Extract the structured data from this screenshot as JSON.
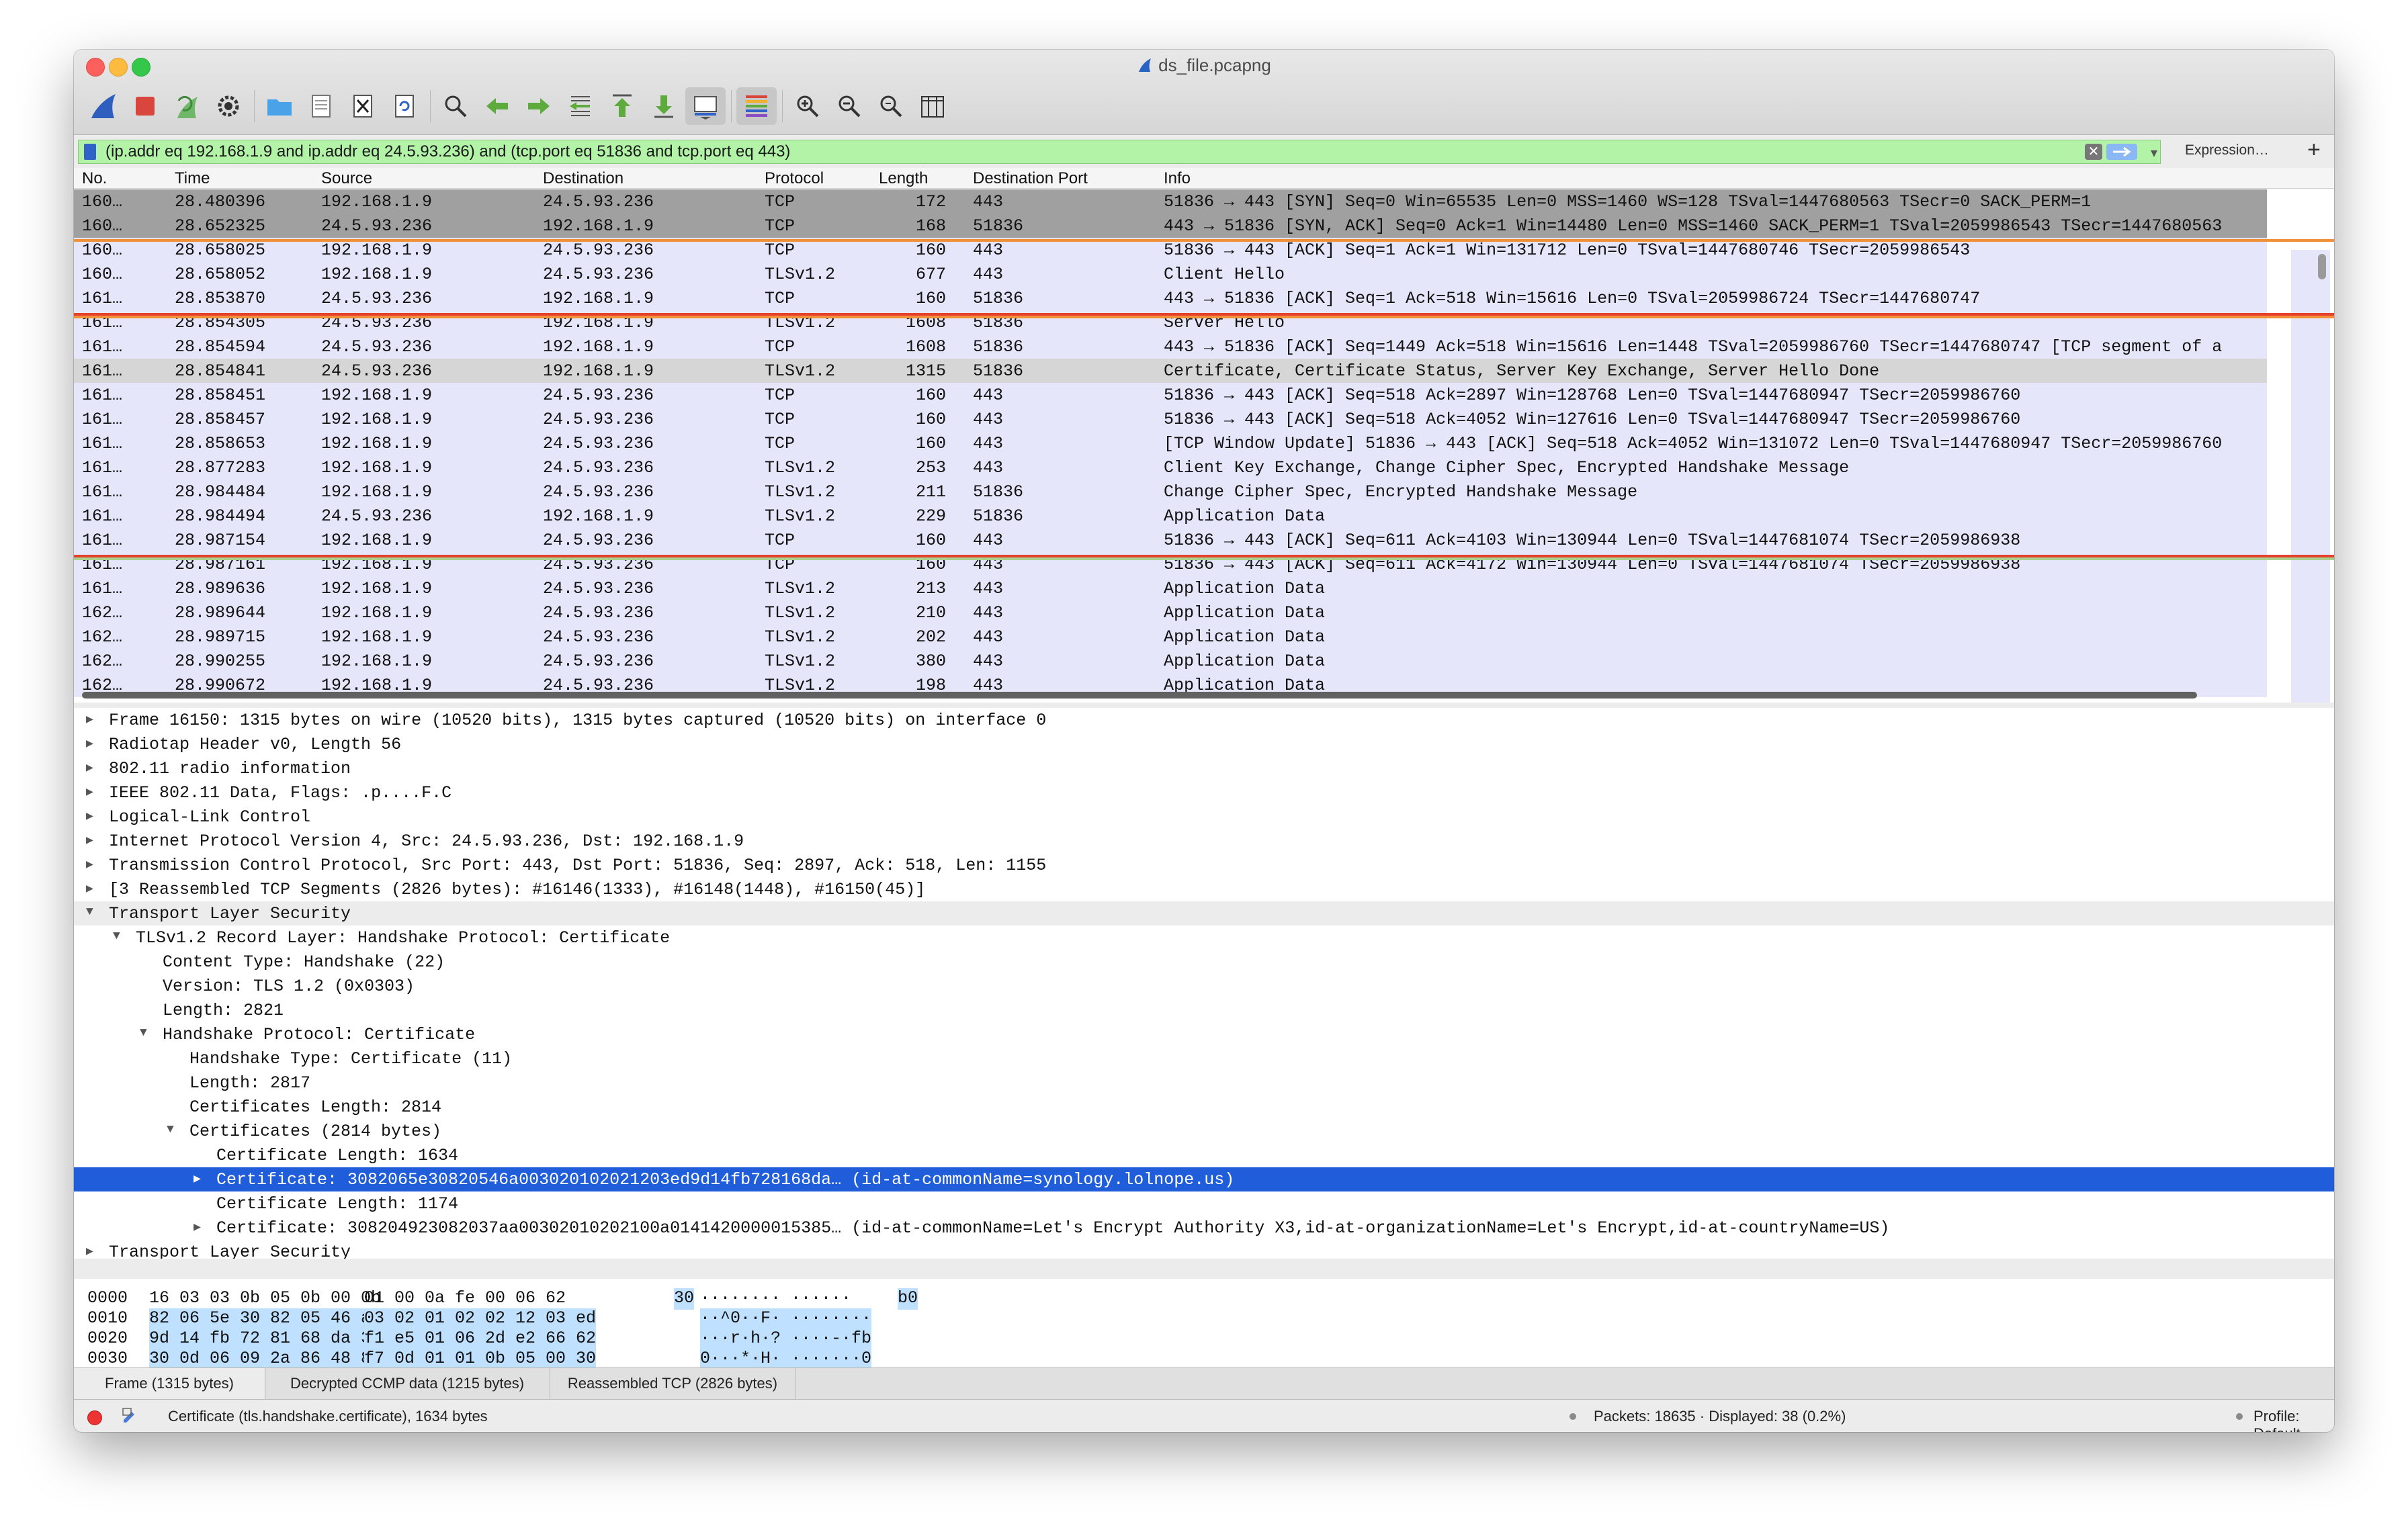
{
  "window": {
    "title": "ds_file.pcapng"
  },
  "filter": {
    "value": "(ip.addr eq 192.168.1.9 and ip.addr eq 24.5.93.236) and (tcp.port eq 51836 and tcp.port eq 443)",
    "expression_label": "Expression…",
    "add_label": "+",
    "clear_glyph": "✕",
    "dropdown_glyph": "▾"
  },
  "columns": [
    "No.",
    "Time",
    "Source",
    "Destination",
    "Protocol",
    "Length",
    "Destination Port",
    "Info"
  ],
  "packets": [
    {
      "no": "160…",
      "time": "28.480396",
      "src": "192.168.1.9",
      "dst": "24.5.93.236",
      "proto": "TCP",
      "len": "172",
      "dport": "443",
      "info": "51836 → 443 [SYN] Seq=0 Win=65535 Len=0 MSS=1460 WS=128 TSval=1447680563 TSecr=0 SACK_PERM=1",
      "style": "dark"
    },
    {
      "no": "160…",
      "time": "28.652325",
      "src": "24.5.93.236",
      "dst": "192.168.1.9",
      "proto": "TCP",
      "len": "168",
      "dport": "51836",
      "info": "443 → 51836 [SYN, ACK] Seq=0 Ack=1 Win=14480 Len=0 MSS=1460 SACK_PERM=1 TSval=2059986543 TSecr=1447680563",
      "style": "dark"
    },
    {
      "no": "160…",
      "time": "28.658025",
      "src": "192.168.1.9",
      "dst": "24.5.93.236",
      "proto": "TCP",
      "len": "160",
      "dport": "443",
      "info": "51836 → 443 [ACK] Seq=1 Ack=1 Win=131712 Len=0 TSval=1447680746 TSecr=2059986543",
      "style": "normal"
    },
    {
      "no": "160…",
      "time": "28.658052",
      "src": "192.168.1.9",
      "dst": "24.5.93.236",
      "proto": "TLSv1.2",
      "len": "677",
      "dport": "443",
      "info": "Client Hello",
      "style": "normal"
    },
    {
      "no": "161…",
      "time": "28.853870",
      "src": "24.5.93.236",
      "dst": "192.168.1.9",
      "proto": "TCP",
      "len": "160",
      "dport": "51836",
      "info": "443 → 51836 [ACK] Seq=1 Ack=518 Win=15616 Len=0 TSval=2059986724 TSecr=1447680747",
      "style": "normal"
    },
    {
      "no": "161…",
      "time": "28.854305",
      "src": "24.5.93.236",
      "dst": "192.168.1.9",
      "proto": "TLSv1.2",
      "len": "1608",
      "dport": "51836",
      "info": "Server Hello",
      "style": "normal"
    },
    {
      "no": "161…",
      "time": "28.854594",
      "src": "24.5.93.236",
      "dst": "192.168.1.9",
      "proto": "TCP",
      "len": "1608",
      "dport": "51836",
      "info": "443 → 51836 [ACK] Seq=1449 Ack=518 Win=15616 Len=1448 TSval=2059986760 TSecr=1447680747 [TCP segment of a",
      "style": "normal"
    },
    {
      "no": "161…",
      "time": "28.854841",
      "src": "24.5.93.236",
      "dst": "192.168.1.9",
      "proto": "TLSv1.2",
      "len": "1315",
      "dport": "51836",
      "info": "Certificate, Certificate Status, Server Key Exchange, Server Hello Done",
      "style": "sel"
    },
    {
      "no": "161…",
      "time": "28.858451",
      "src": "192.168.1.9",
      "dst": "24.5.93.236",
      "proto": "TCP",
      "len": "160",
      "dport": "443",
      "info": "51836 → 443 [ACK] Seq=518 Ack=2897 Win=128768 Len=0 TSval=1447680947 TSecr=2059986760",
      "style": "normal"
    },
    {
      "no": "161…",
      "time": "28.858457",
      "src": "192.168.1.9",
      "dst": "24.5.93.236",
      "proto": "TCP",
      "len": "160",
      "dport": "443",
      "info": "51836 → 443 [ACK] Seq=518 Ack=4052 Win=127616 Len=0 TSval=1447680947 TSecr=2059986760",
      "style": "normal"
    },
    {
      "no": "161…",
      "time": "28.858653",
      "src": "192.168.1.9",
      "dst": "24.5.93.236",
      "proto": "TCP",
      "len": "160",
      "dport": "443",
      "info": "[TCP Window Update] 51836 → 443 [ACK] Seq=518 Ack=4052 Win=131072 Len=0 TSval=1447680947 TSecr=2059986760",
      "style": "normal"
    },
    {
      "no": "161…",
      "time": "28.877283",
      "src": "192.168.1.9",
      "dst": "24.5.93.236",
      "proto": "TLSv1.2",
      "len": "253",
      "dport": "443",
      "info": "Client Key Exchange, Change Cipher Spec, Encrypted Handshake Message",
      "style": "normal"
    },
    {
      "no": "161…",
      "time": "28.984484",
      "src": "192.168.1.9",
      "dst": "24.5.93.236",
      "proto": "TLSv1.2",
      "len": "211",
      "dport": "51836",
      "info": "Change Cipher Spec, Encrypted Handshake Message",
      "style": "normal"
    },
    {
      "no": "161…",
      "time": "28.984494",
      "src": "24.5.93.236",
      "dst": "192.168.1.9",
      "proto": "TLSv1.2",
      "len": "229",
      "dport": "51836",
      "info": "Application Data",
      "style": "normal"
    },
    {
      "no": "161…",
      "time": "28.987154",
      "src": "192.168.1.9",
      "dst": "24.5.93.236",
      "proto": "TCP",
      "len": "160",
      "dport": "443",
      "info": "51836 → 443 [ACK] Seq=611 Ack=4103 Win=130944 Len=0 TSval=1447681074 TSecr=2059986938",
      "style": "normal"
    },
    {
      "no": "161…",
      "time": "28.987161",
      "src": "192.168.1.9",
      "dst": "24.5.93.236",
      "proto": "TCP",
      "len": "160",
      "dport": "443",
      "info": "51836 → 443 [ACK] Seq=611 Ack=4172 Win=130944 Len=0 TSval=1447681074 TSecr=2059986938",
      "style": "normal"
    },
    {
      "no": "161…",
      "time": "28.989636",
      "src": "192.168.1.9",
      "dst": "24.5.93.236",
      "proto": "TLSv1.2",
      "len": "213",
      "dport": "443",
      "info": "Application Data",
      "style": "normal"
    },
    {
      "no": "162…",
      "time": "28.989644",
      "src": "192.168.1.9",
      "dst": "24.5.93.236",
      "proto": "TLSv1.2",
      "len": "210",
      "dport": "443",
      "info": "Application Data",
      "style": "normal"
    },
    {
      "no": "162…",
      "time": "28.989715",
      "src": "192.168.1.9",
      "dst": "24.5.93.236",
      "proto": "TLSv1.2",
      "len": "202",
      "dport": "443",
      "info": "Application Data",
      "style": "normal"
    },
    {
      "no": "162…",
      "time": "28.990255",
      "src": "192.168.1.9",
      "dst": "24.5.93.236",
      "proto": "TLSv1.2",
      "len": "380",
      "dport": "443",
      "info": "Application Data",
      "style": "normal"
    },
    {
      "no": "162…",
      "time": "28.990672",
      "src": "192.168.1.9",
      "dst": "24.5.93.236",
      "proto": "TLSv1.2",
      "len": "198",
      "dport": "443",
      "info": "Application Data",
      "style": "normal"
    }
  ],
  "highlight_colors": {
    "handshake": "#f0913a",
    "tls_setup": "#e8402e",
    "app_data": "#a9d18e"
  },
  "details": [
    {
      "indent": 0,
      "twisty": "▶",
      "text": "Frame 16150: 1315 bytes on wire (10520 bits), 1315 bytes captured (10520 bits) on interface 0",
      "style": "normal"
    },
    {
      "indent": 0,
      "twisty": "▶",
      "text": "Radiotap Header v0, Length 56",
      "style": "normal"
    },
    {
      "indent": 0,
      "twisty": "▶",
      "text": "802.11 radio information",
      "style": "normal"
    },
    {
      "indent": 0,
      "twisty": "▶",
      "text": "IEEE 802.11 Data, Flags: .p....F.C",
      "style": "normal"
    },
    {
      "indent": 0,
      "twisty": "▶",
      "text": "Logical-Link Control",
      "style": "normal"
    },
    {
      "indent": 0,
      "twisty": "▶",
      "text": "Internet Protocol Version 4, Src: 24.5.93.236, Dst: 192.168.1.9",
      "style": "normal"
    },
    {
      "indent": 0,
      "twisty": "▶",
      "text": "Transmission Control Protocol, Src Port: 443, Dst Port: 51836, Seq: 2897, Ack: 518, Len: 1155",
      "style": "normal"
    },
    {
      "indent": 0,
      "twisty": "▶",
      "text": "[3 Reassembled TCP Segments (2826 bytes): #16146(1333), #16148(1448), #16150(45)]",
      "style": "normal"
    },
    {
      "indent": 0,
      "twisty": "▼",
      "text": "Transport Layer Security",
      "style": "sec"
    },
    {
      "indent": 1,
      "twisty": "▼",
      "text": "TLSv1.2 Record Layer: Handshake Protocol: Certificate",
      "style": "normal"
    },
    {
      "indent": 2,
      "twisty": "",
      "text": "Content Type: Handshake (22)",
      "style": "normal"
    },
    {
      "indent": 2,
      "twisty": "",
      "text": "Version: TLS 1.2 (0x0303)",
      "style": "normal"
    },
    {
      "indent": 2,
      "twisty": "",
      "text": "Length: 2821",
      "style": "normal"
    },
    {
      "indent": 2,
      "twisty": "▼",
      "text": "Handshake Protocol: Certificate",
      "style": "normal"
    },
    {
      "indent": 3,
      "twisty": "",
      "text": "Handshake Type: Certificate (11)",
      "style": "normal"
    },
    {
      "indent": 3,
      "twisty": "",
      "text": "Length: 2817",
      "style": "normal"
    },
    {
      "indent": 3,
      "twisty": "",
      "text": "Certificates Length: 2814",
      "style": "normal"
    },
    {
      "indent": 3,
      "twisty": "▼",
      "text": "Certificates (2814 bytes)",
      "style": "normal"
    },
    {
      "indent": 4,
      "twisty": "",
      "text": "Certificate Length: 1634",
      "style": "normal"
    },
    {
      "indent": 4,
      "twisty": "▶",
      "text": "Certificate: 3082065e30820546a003020102021203ed9d14fb728168da… (id-at-commonName=synology.lolnope.us)",
      "style": "sel"
    },
    {
      "indent": 4,
      "twisty": "",
      "text": "Certificate Length: 1174",
      "style": "normal"
    },
    {
      "indent": 4,
      "twisty": "▶",
      "text": "Certificate: 308204923082037aa00302010202100a0141420000015385… (id-at-commonName=Let's Encrypt Authority X3,id-at-organizationName=Let's Encrypt,id-at-countryName=US)",
      "style": "normal"
    },
    {
      "indent": 0,
      "twisty": "▶",
      "text": "Transport Layer Security",
      "style": "normal"
    }
  ],
  "hex": [
    {
      "offset": "0000",
      "bytes_a": "16 03 03 0b 05 0b 00 0b",
      "bytes_b": "01 00 0a fe 00 06 62 ",
      "bytes_b_hl": "30",
      "ascii_a": "········ ······",
      "ascii_hl": "b0"
    },
    {
      "offset": "0010",
      "bytes_a": "82 06 5e 30 82 05 46 a0",
      "bytes_b": "03 02 01 02 02 12 03 ed",
      "bytes_b_hl": "",
      "ascii_a": "",
      "ascii_hl": "··^0··F· ········"
    },
    {
      "offset": "0020",
      "bytes_a": "9d 14 fb 72 81 68 da 3f",
      "bytes_b": "f1 e5 01 06 2d e2 66 62",
      "bytes_b_hl": "",
      "ascii_a": "",
      "ascii_hl": "···r·h·? ····-·fb"
    },
    {
      "offset": "0030",
      "bytes_a": "30 0d 06 09 2a 86 48 86",
      "bytes_b": "f7 0d 01 01 0b 05 00 30",
      "bytes_b_hl": "",
      "ascii_a": "",
      "ascii_hl": "0···*·H· ·······0"
    }
  ],
  "bottom_tabs": [
    "Frame (1315 bytes)",
    "Decrypted CCMP data (1215 bytes)",
    "Reassembled TCP (2826 bytes)"
  ],
  "status": {
    "field": "Certificate (tls.handshake.certificate), 1634 bytes",
    "packets": "Packets: 18635 · Displayed: 38 (0.2%)",
    "profile": "Profile: Default"
  }
}
